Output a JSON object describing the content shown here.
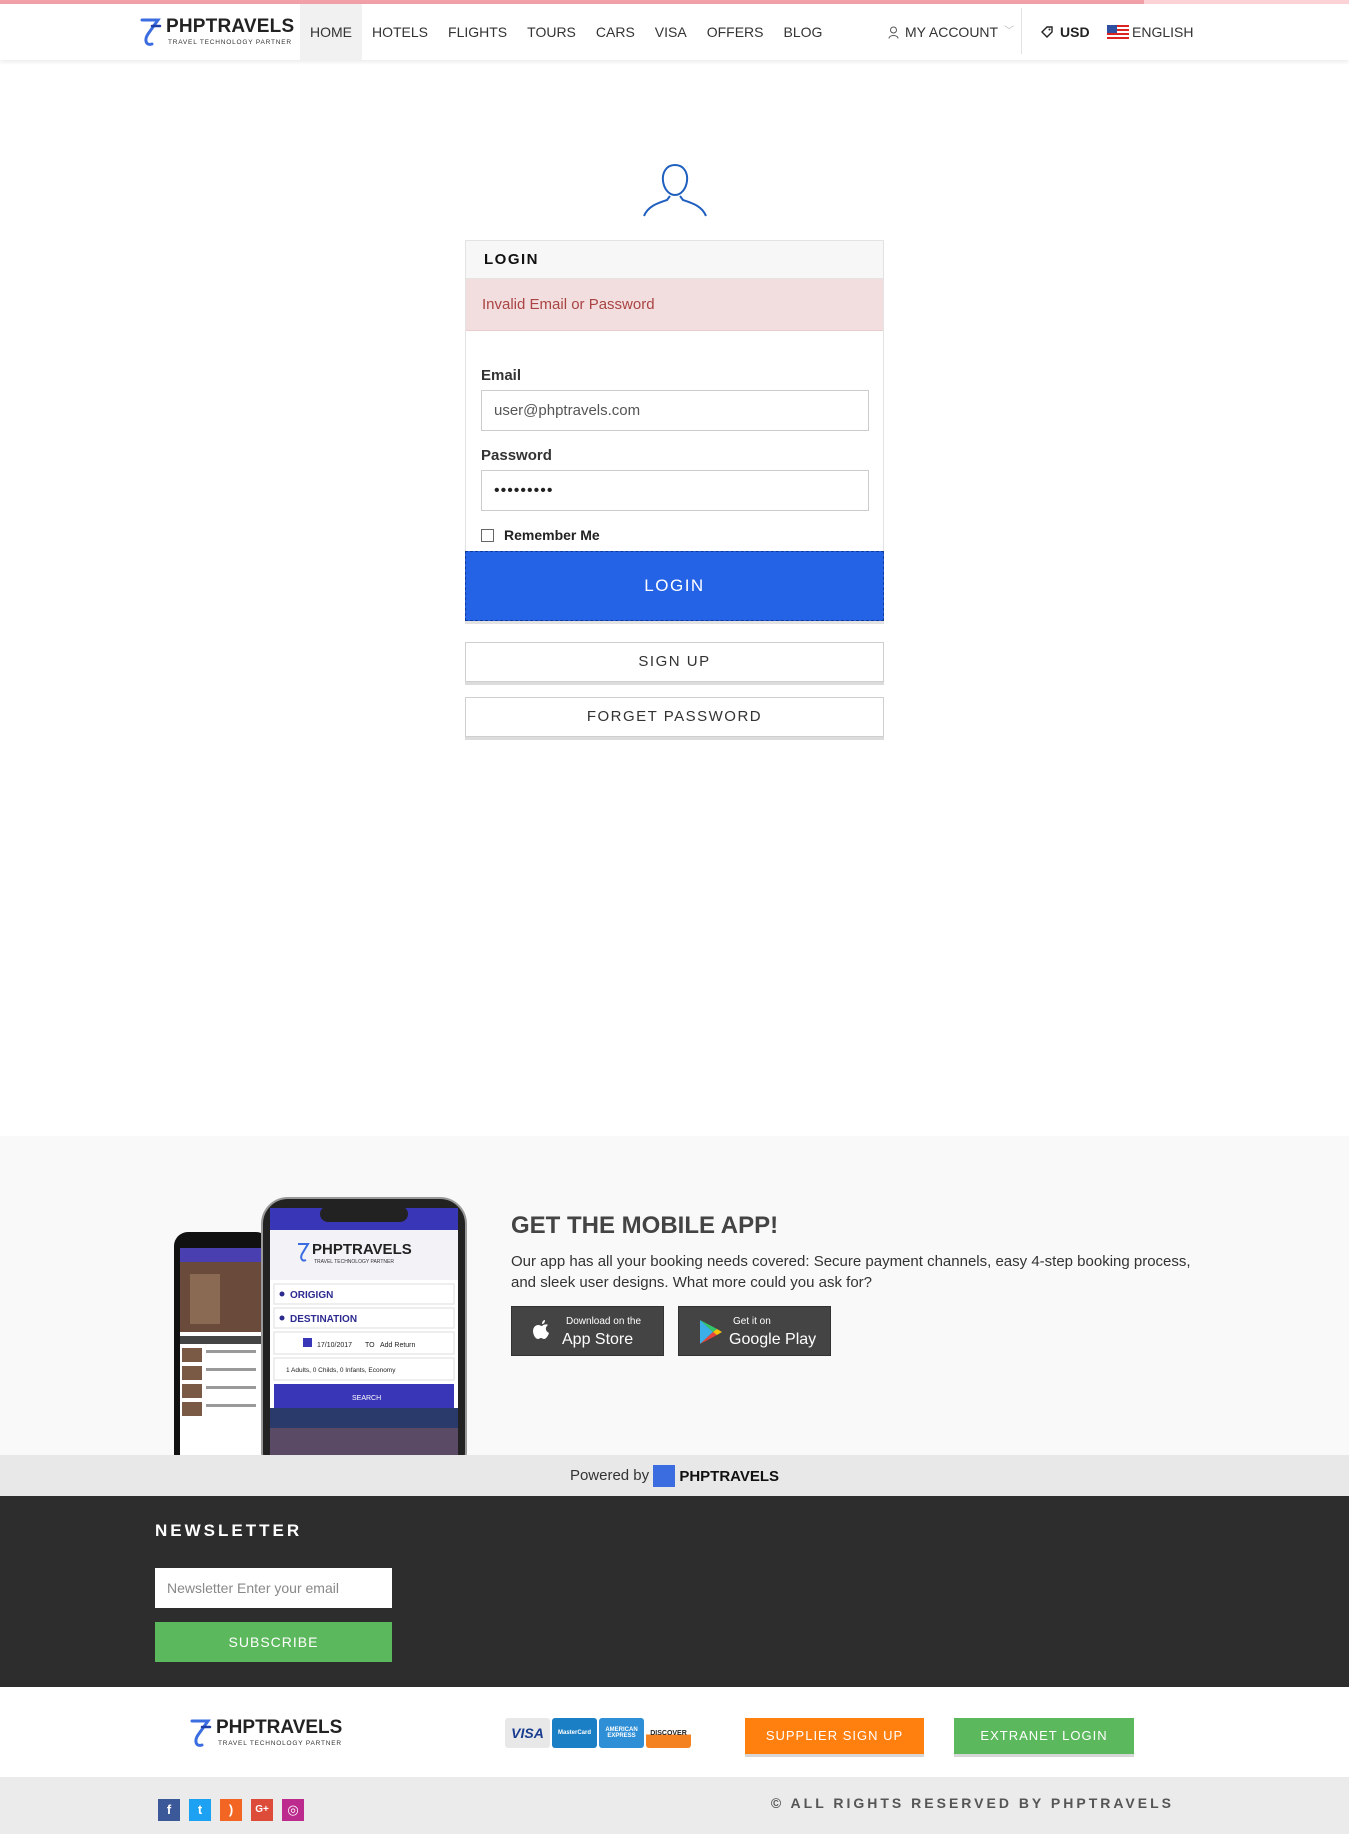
{
  "brand": {
    "name": "PHPTRAVELS",
    "tagline": "TRAVEL TECHNOLOGY PARTNER"
  },
  "nav": {
    "items": [
      {
        "label": "HOME",
        "active": true
      },
      {
        "label": "HOTELS"
      },
      {
        "label": "FLIGHTS"
      },
      {
        "label": "TOURS"
      },
      {
        "label": "CARS"
      },
      {
        "label": "VISA"
      },
      {
        "label": "OFFERS"
      },
      {
        "label": "BLOG"
      }
    ],
    "account": "MY ACCOUNT",
    "currency": "USD",
    "language": "ENGLISH"
  },
  "login": {
    "heading": "LOGIN",
    "error": "Invalid Email or Password",
    "email_label": "Email",
    "email_value": "user@phptravels.com",
    "password_label": "Password",
    "password_value": "•••••••••",
    "remember_label": "Remember Me",
    "login_button": "LOGIN",
    "signup_button": "SIGN UP",
    "forget_button": "FORGET PASSWORD"
  },
  "app": {
    "title": "GET THE MOBILE APP!",
    "description": "Our app has all your booking needs covered: Secure payment channels, easy 4-step booking process, and sleek user designs. What more could you ask for?",
    "appstore_small": "Download on the",
    "appstore_big": "App Store",
    "play_small": "Get it on",
    "play_big": "Google Play",
    "phone": {
      "origin": "ORIGIGN",
      "destination": "DESTINATION",
      "date": "17/10/2017",
      "to": "TO",
      "add_return": "Add Return",
      "travellers": "1 Adults, 0 Childs, 0 Infants, Economy",
      "search": "SEARCH"
    }
  },
  "powered": {
    "text": "Powered by",
    "brand": "PHPTRAVELS"
  },
  "newsletter": {
    "title": "NEWSLETTER",
    "placeholder": "Newsletter Enter your email",
    "button": "SUBSCRIBE"
  },
  "footer": {
    "cards": [
      "VISA",
      "MasterCard",
      "AMERICAN EXPRESS",
      "DISCOVER"
    ],
    "supplier_button": "SUPPLIER SIGN UP",
    "extranet_button": "EXTRANET LOGIN",
    "copyright": "© ALL RIGHTS RESERVED BY PHPTRAVELS",
    "social": [
      "facebook-icon",
      "twitter-icon",
      "rss-icon",
      "google-plus-icon",
      "instagram-icon"
    ]
  },
  "colors": {
    "primary": "#2563e6",
    "alert_bg": "#f2dede",
    "alert_text": "#a94442",
    "success": "#5cb85c",
    "orange": "#ff7f0f",
    "dark": "#2d2d2d"
  }
}
